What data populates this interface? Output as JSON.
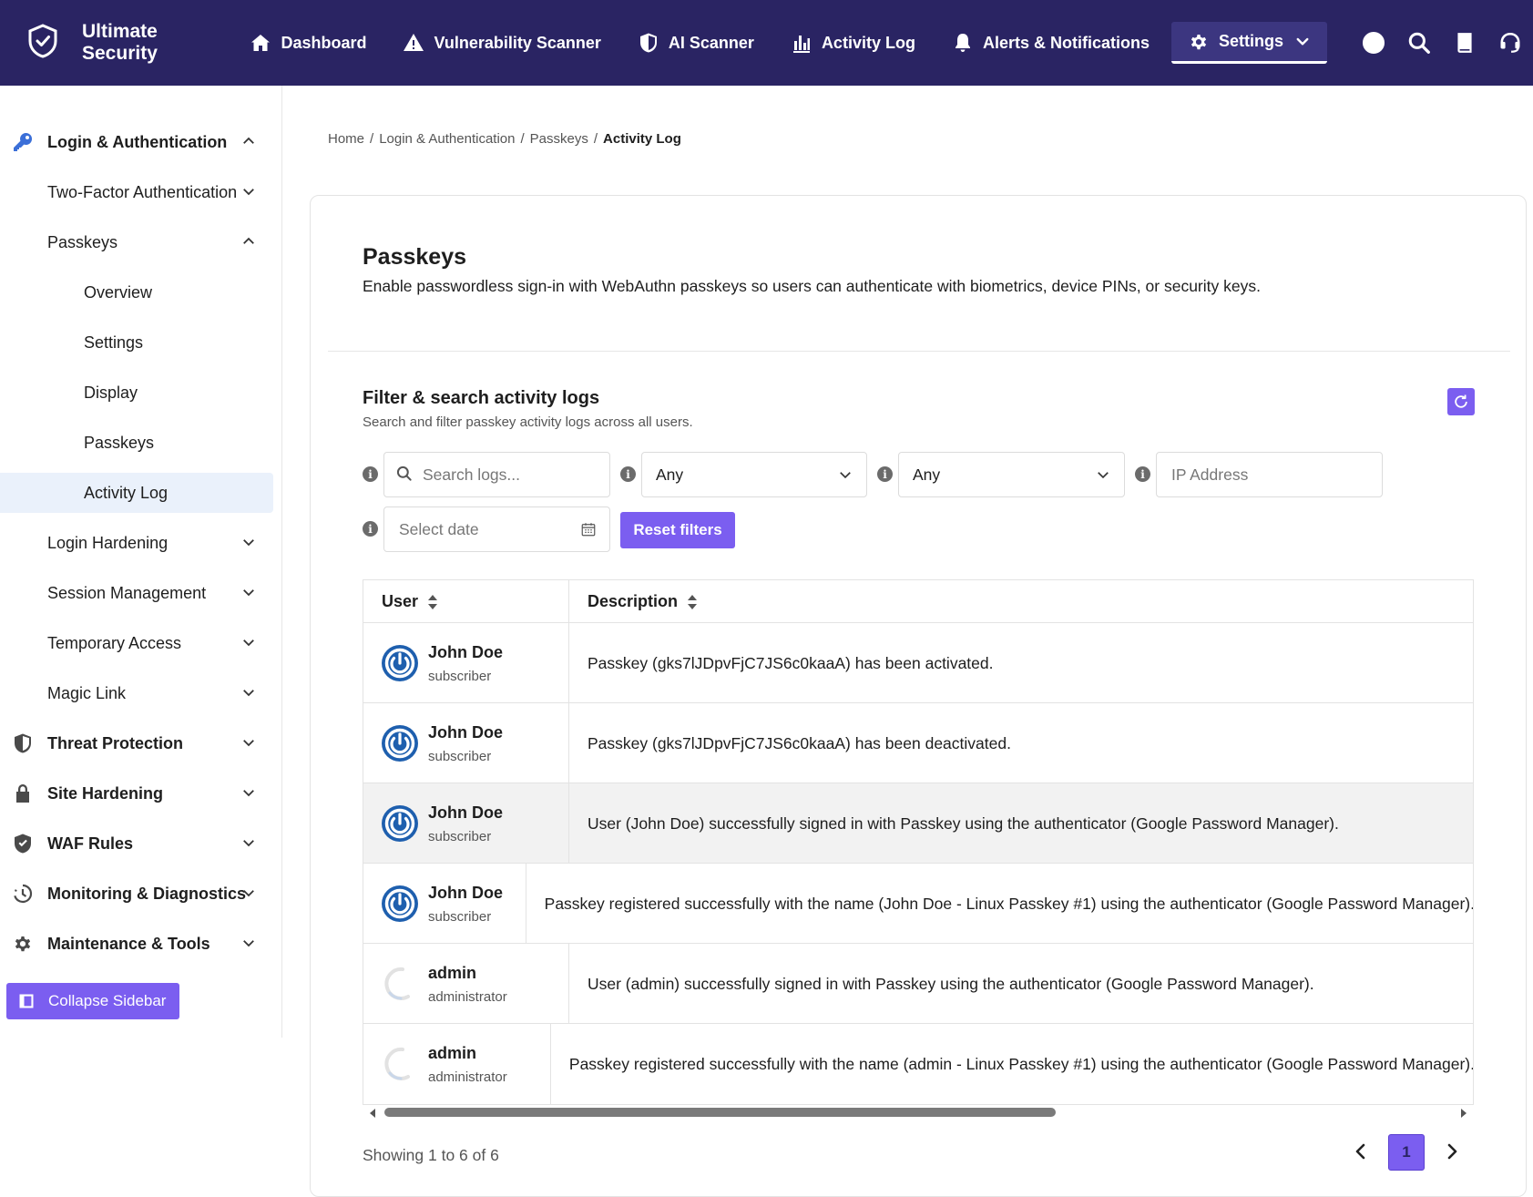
{
  "app": {
    "title": "Ultimate Security"
  },
  "topnav": {
    "items": [
      {
        "label": "Dashboard",
        "icon": "home-icon"
      },
      {
        "label": "Vulnerability Scanner",
        "icon": "warning-icon"
      },
      {
        "label": "AI Scanner",
        "icon": "shield-icon"
      },
      {
        "label": "Activity Log",
        "icon": "bar-chart-icon"
      },
      {
        "label": "Alerts & Notifications",
        "icon": "bell-icon"
      },
      {
        "label": "Settings",
        "icon": "gear-icon"
      }
    ],
    "utility_icons": [
      "dark-mode-icon",
      "search-icon",
      "docs-icon",
      "support-icon"
    ]
  },
  "sidebar": {
    "sections": [
      {
        "label": "Login & Authentication",
        "icon": "key-icon",
        "expanded": true
      },
      {
        "label": "Two-Factor Authentication"
      },
      {
        "label": "Passkeys",
        "expanded": true
      },
      {
        "label": "Overview"
      },
      {
        "label": "Settings"
      },
      {
        "label": "Display"
      },
      {
        "label": "Passkeys"
      },
      {
        "label": "Activity Log",
        "selected": true
      },
      {
        "label": "Login Hardening"
      },
      {
        "label": "Session Management"
      },
      {
        "label": "Temporary Access"
      },
      {
        "label": "Magic Link"
      },
      {
        "label": "Threat Protection",
        "icon": "shield-icon"
      },
      {
        "label": "Site Hardening",
        "icon": "lock-icon"
      },
      {
        "label": "WAF Rules",
        "icon": "shield-check-icon"
      },
      {
        "label": "Monitoring & Diagnostics",
        "icon": "history-icon"
      },
      {
        "label": "Maintenance & Tools",
        "icon": "gear-icon"
      }
    ],
    "collapse_label": "Collapse Sidebar"
  },
  "breadcrumb": {
    "items": [
      "Home",
      "Login & Authentication",
      "Passkeys"
    ],
    "current": "Activity Log",
    "separator": "/"
  },
  "page": {
    "title": "Passkeys",
    "description": "Enable passwordless sign-in with WebAuthn passkeys so users can authenticate with biometrics, device PINs, or security keys."
  },
  "filters": {
    "title": "Filter & search activity logs",
    "description": "Search and filter passkey activity logs across all users.",
    "search_placeholder": "Search logs...",
    "select1_value": "Any",
    "select2_value": "Any",
    "ip_placeholder": "IP Address",
    "date_placeholder": "Select date",
    "reset_label": "Reset filters",
    "info_glyph": "i"
  },
  "table": {
    "columns": [
      "User",
      "Description"
    ],
    "rows": [
      {
        "name": "John Doe",
        "role": "subscriber",
        "description": "Passkey (gks7lJDpvFjC7JS6c0kaaA) has been activated."
      },
      {
        "name": "John Doe",
        "role": "subscriber",
        "description": "Passkey (gks7lJDpvFjC7JS6c0kaaA) has been deactivated."
      },
      {
        "name": "John Doe",
        "role": "subscriber",
        "description": "User (John Doe) successfully signed in with Passkey using the authenticator (Google Password Manager)."
      },
      {
        "name": "John Doe",
        "role": "subscriber",
        "description": "Passkey registered successfully with the name (John Doe - Linux Passkey #1) using the authenticator (Google Password Manager)."
      },
      {
        "name": "admin",
        "role": "administrator",
        "description": "User (admin) successfully signed in with Passkey using the authenticator (Google Password Manager)."
      },
      {
        "name": "admin",
        "role": "administrator",
        "description": "Passkey registered successfully with the name (admin - Linux Passkey #1) using the authenticator (Google Password Manager)."
      }
    ]
  },
  "pagination": {
    "showing": "Showing 1 to 6 of 6",
    "current_page": "1"
  },
  "colors": {
    "topbar": "#2a2463",
    "accent": "#7b5ef0",
    "selected_bg": "#eaf1fb"
  }
}
